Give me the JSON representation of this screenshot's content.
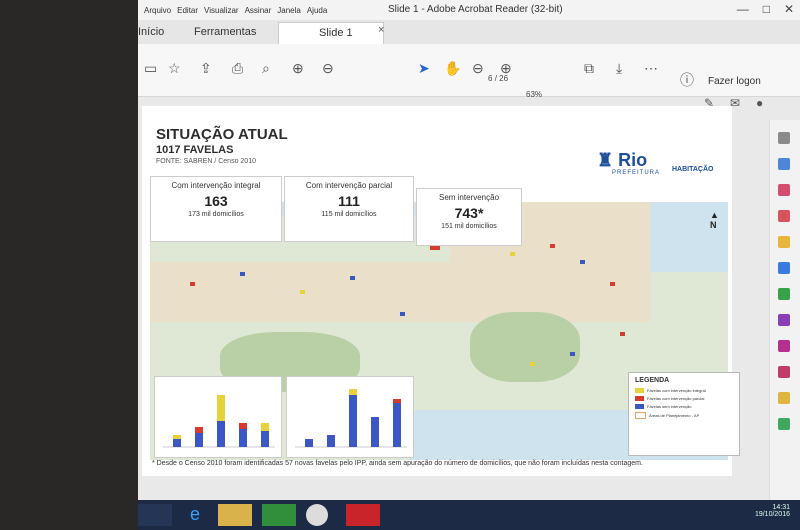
{
  "window": {
    "title": "Slide 1 - Adobe Acrobat Reader (32-bit)",
    "menu": [
      "Arquivo",
      "Editar",
      "Visualizar",
      "Assinar",
      "Janela",
      "Ajuda"
    ],
    "controls": [
      "—",
      "□",
      "✕"
    ]
  },
  "tabs": {
    "home": "Início",
    "tools": "Ferramentas",
    "document": "Slide 1",
    "close": "×"
  },
  "toolbar": {
    "page_current": "6",
    "page_total": "/ 26",
    "zoom": "63%",
    "login": "Fazer logon"
  },
  "slide": {
    "title": "SITUAÇÃO ATUAL",
    "subtitle": "1017 FAVELAS",
    "source": "FONTE: SABREN / Censo 2010",
    "brand": "Rio",
    "brand_sub": "PREFEITURA",
    "brand_unit": "HABITAÇÃO",
    "stats": [
      {
        "header": "Com intervenção integral",
        "value": "163",
        "detail": "173 mil domicílios"
      },
      {
        "header": "Com intervenção parcial",
        "value": "111",
        "detail": "115 mil domicílios"
      },
      {
        "header": "Sem intervenção",
        "value": "743*",
        "detail": "151 mil domicílios"
      }
    ],
    "north": "N",
    "legend": {
      "title": "LEGENDA",
      "items": [
        {
          "label": "Favelas com intervenção integral",
          "color": "#e8d23a"
        },
        {
          "label": "Favelas com intervenção parcial",
          "color": "#d63b2f"
        },
        {
          "label": "Favelas sem intervenção",
          "color": "#3a57c4"
        },
        {
          "label": "Áreas de Planejamento - AP",
          "color": "#e7a36b"
        }
      ]
    },
    "footnote": "* Desde o Censo 2010 foram identificadas 57 novas favelas pelo IPP, ainda sem apuração do número de domicílios, que não foram incluídas nesta contagem."
  },
  "taskbar": {
    "time": "14:31",
    "date": "19/10/2016"
  }
}
